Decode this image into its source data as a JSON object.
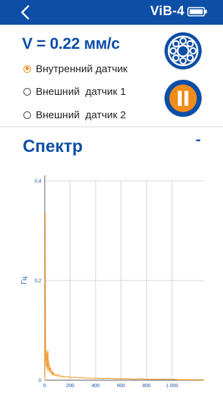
{
  "header": {
    "device_name": "ViB-4",
    "back_icon": "chevron-left-icon",
    "battery_icon": "battery-icon"
  },
  "reading": {
    "text": "V = 0.22 мм/с"
  },
  "sensors": [
    {
      "label": "Внутренний датчик",
      "selected": true
    },
    {
      "label": "Внешний  датчик 1",
      "selected": false
    },
    {
      "label": "Внешний  датчик 2",
      "selected": false
    }
  ],
  "buttons": {
    "bearing_icon": "bearing-icon",
    "pause_icon": "pause-icon"
  },
  "spectrum": {
    "title": "Спектр",
    "collapse_label": "-"
  },
  "colors": {
    "primary": "#0d4ea6",
    "accent": "#f08c1a",
    "series": "#f5a03a"
  },
  "chart_data": {
    "type": "line",
    "title": "",
    "xlabel": "",
    "ylabel": "Гц",
    "xlim": [
      0,
      1250
    ],
    "ylim": [
      0,
      0.4
    ],
    "x_ticks": [
      0,
      200,
      400,
      600,
      800,
      1000
    ],
    "x_tick_labels": [
      "0",
      "200",
      "400",
      "600",
      "800",
      "1 000"
    ],
    "y_ticks": [
      0,
      0.2,
      0.4
    ],
    "y_tick_labels": [
      "0",
      "0,2",
      "0,4"
    ],
    "grid": true,
    "series": [
      {
        "name": "",
        "x": [
          0,
          2,
          4,
          6,
          8,
          10,
          12,
          14,
          16,
          18,
          20,
          22,
          25,
          28,
          30,
          33,
          36,
          40,
          45,
          50,
          55,
          60,
          65,
          70,
          80,
          90,
          100,
          110,
          120,
          130,
          140,
          150,
          170,
          190,
          210,
          230,
          260,
          300,
          340,
          380,
          420,
          460,
          500,
          550,
          600,
          650,
          700,
          750,
          800,
          850,
          900,
          950,
          1000,
          1050,
          1100,
          1150,
          1200,
          1250
        ],
        "y": [
          0.0,
          0.02,
          0.335,
          0.15,
          0.04,
          0.06,
          0.03,
          0.045,
          0.025,
          0.055,
          0.035,
          0.02,
          0.06,
          0.03,
          0.04,
          0.02,
          0.03,
          0.015,
          0.025,
          0.02,
          0.012,
          0.018,
          0.01,
          0.015,
          0.009,
          0.012,
          0.008,
          0.011,
          0.007,
          0.009,
          0.006,
          0.008,
          0.006,
          0.007,
          0.005,
          0.006,
          0.005,
          0.005,
          0.004,
          0.004,
          0.004,
          0.003,
          0.004,
          0.003,
          0.003,
          0.003,
          0.002,
          0.003,
          0.002,
          0.002,
          0.002,
          0.002,
          0.002,
          0.001,
          0.001,
          0.001,
          0.001,
          0.001
        ]
      }
    ]
  }
}
